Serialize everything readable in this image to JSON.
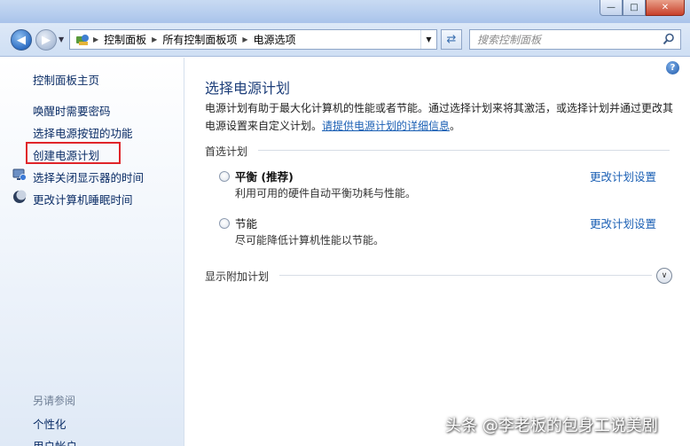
{
  "window": {
    "minimize_glyph": "—",
    "maximize_glyph": "□",
    "close_glyph": "✕"
  },
  "address_bar": {
    "crumbs": [
      "控制面板",
      "所有控制面板项",
      "电源选项"
    ],
    "search_placeholder": "搜索控制面板"
  },
  "sidebar": {
    "home": "控制面板主页",
    "items": [
      {
        "label": "唤醒时需要密码",
        "icon": ""
      },
      {
        "label": "选择电源按钮的功能",
        "icon": ""
      },
      {
        "label": "创建电源计划",
        "icon": "",
        "highlighted": true
      },
      {
        "label": "选择关闭显示器的时间",
        "icon": "monitor-icon"
      },
      {
        "label": "更改计算机睡眠时间",
        "icon": "moon-icon"
      }
    ],
    "see_also_title": "另请参阅",
    "see_also": [
      "个性化",
      "用户帐户"
    ]
  },
  "main": {
    "title": "选择电源计划",
    "description": "电源计划有助于最大化计算机的性能或者节能。通过选择计划来将其激活，或选择计划并通过更改其电源设置来自定义计划。",
    "description_link": "请提供电源计划的详细信息",
    "description_end": "。",
    "preferred_header": "首选计划",
    "plans": [
      {
        "name": "平衡 (推荐)",
        "desc": "利用可用的硬件自动平衡功耗与性能。",
        "change": "更改计划设置"
      },
      {
        "name": "节能",
        "desc": "尽可能降低计算机性能以节能。",
        "change": "更改计划设置"
      }
    ],
    "extra_header": "显示附加计划",
    "help_glyph": "?"
  },
  "watermark": "头条 @李老板的包身工说美剧"
}
